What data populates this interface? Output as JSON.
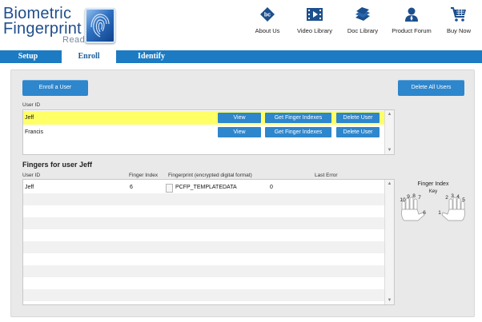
{
  "logo": {
    "line1": "Biometric",
    "line2": "Fingerprint",
    "line3": "Reader"
  },
  "nav": [
    {
      "label": "About Us",
      "icon": "about-us-icon"
    },
    {
      "label": "Video Library",
      "icon": "video-library-icon"
    },
    {
      "label": "Doc Library",
      "icon": "doc-library-icon"
    },
    {
      "label": "Product Forum",
      "icon": "product-forum-icon"
    },
    {
      "label": "Buy Now",
      "icon": "shopping-cart-icon"
    }
  ],
  "tabs": [
    {
      "label": "Setup",
      "active": false
    },
    {
      "label": "Enroll",
      "active": true
    },
    {
      "label": "Identify",
      "active": false
    }
  ],
  "enroll_button": "Enroll a User",
  "delete_all_button": "Delete All Users",
  "users_header": "User ID",
  "users": [
    {
      "name": "Jeff",
      "selected": true
    },
    {
      "name": "Francis",
      "selected": false
    }
  ],
  "row_buttons": {
    "view": "View",
    "get_indexes": "Get Finger Indexes",
    "delete": "Delete User"
  },
  "fingers_title": "Fingers for user Jeff",
  "fingers_columns": {
    "user_id": "User ID",
    "finger_index": "Finger Index",
    "fingerprint": "Fingerprint (encrypted digital format)",
    "last_error": "Last Error"
  },
  "fingers_rows": [
    {
      "user_id": "Jeff",
      "finger_index": "6",
      "fingerprint": "PCFP_TEMPLATEDATA",
      "last_error": "0"
    }
  ],
  "finger_key": {
    "title_line1": "Finger Index",
    "title_line2": "Key",
    "numbers": [
      "10",
      "9",
      "8",
      "7",
      "6",
      "1",
      "2",
      "3",
      "4",
      "5"
    ]
  },
  "colors": {
    "brand_blue": "#1c7bc2",
    "button_blue": "#2e86cc",
    "selected_row": "#ffff66"
  }
}
